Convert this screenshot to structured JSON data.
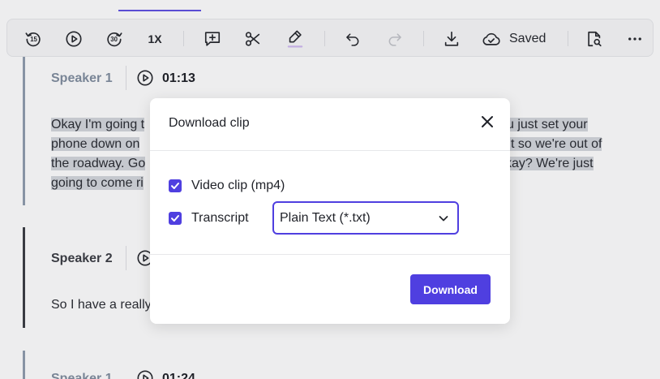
{
  "toolbar": {
    "rewind_label": "15",
    "forward_label": "30",
    "speed": "1X",
    "saved_label": "Saved"
  },
  "transcript": {
    "blocks": [
      {
        "speaker": "Speaker 1",
        "time": "01:13",
        "lines": [
          "Okay I'm going t",
          "phone down on",
          "the roadway. Go",
          "going to come ri"
        ],
        "lines_right": [
          "u just set your",
          "t so we're out of",
          "kay? We're just"
        ]
      },
      {
        "speaker": "Speaker 2",
        "text": "So I have a really"
      },
      {
        "speaker": "Speaker 1",
        "time": "01:24"
      }
    ]
  },
  "colors": {
    "accent": "#4f3fe0",
    "highlight": "#c9cdd3",
    "speaker1_bar": "#8a96a8",
    "speaker2_bar": "#3b3d44"
  },
  "modal": {
    "title": "Download clip",
    "options": [
      {
        "label": "Video clip (mp4)",
        "checked": true
      },
      {
        "label": "Transcript",
        "checked": true
      }
    ],
    "format_select": {
      "value": "Plain Text (*.txt)"
    },
    "download_label": "Download"
  }
}
